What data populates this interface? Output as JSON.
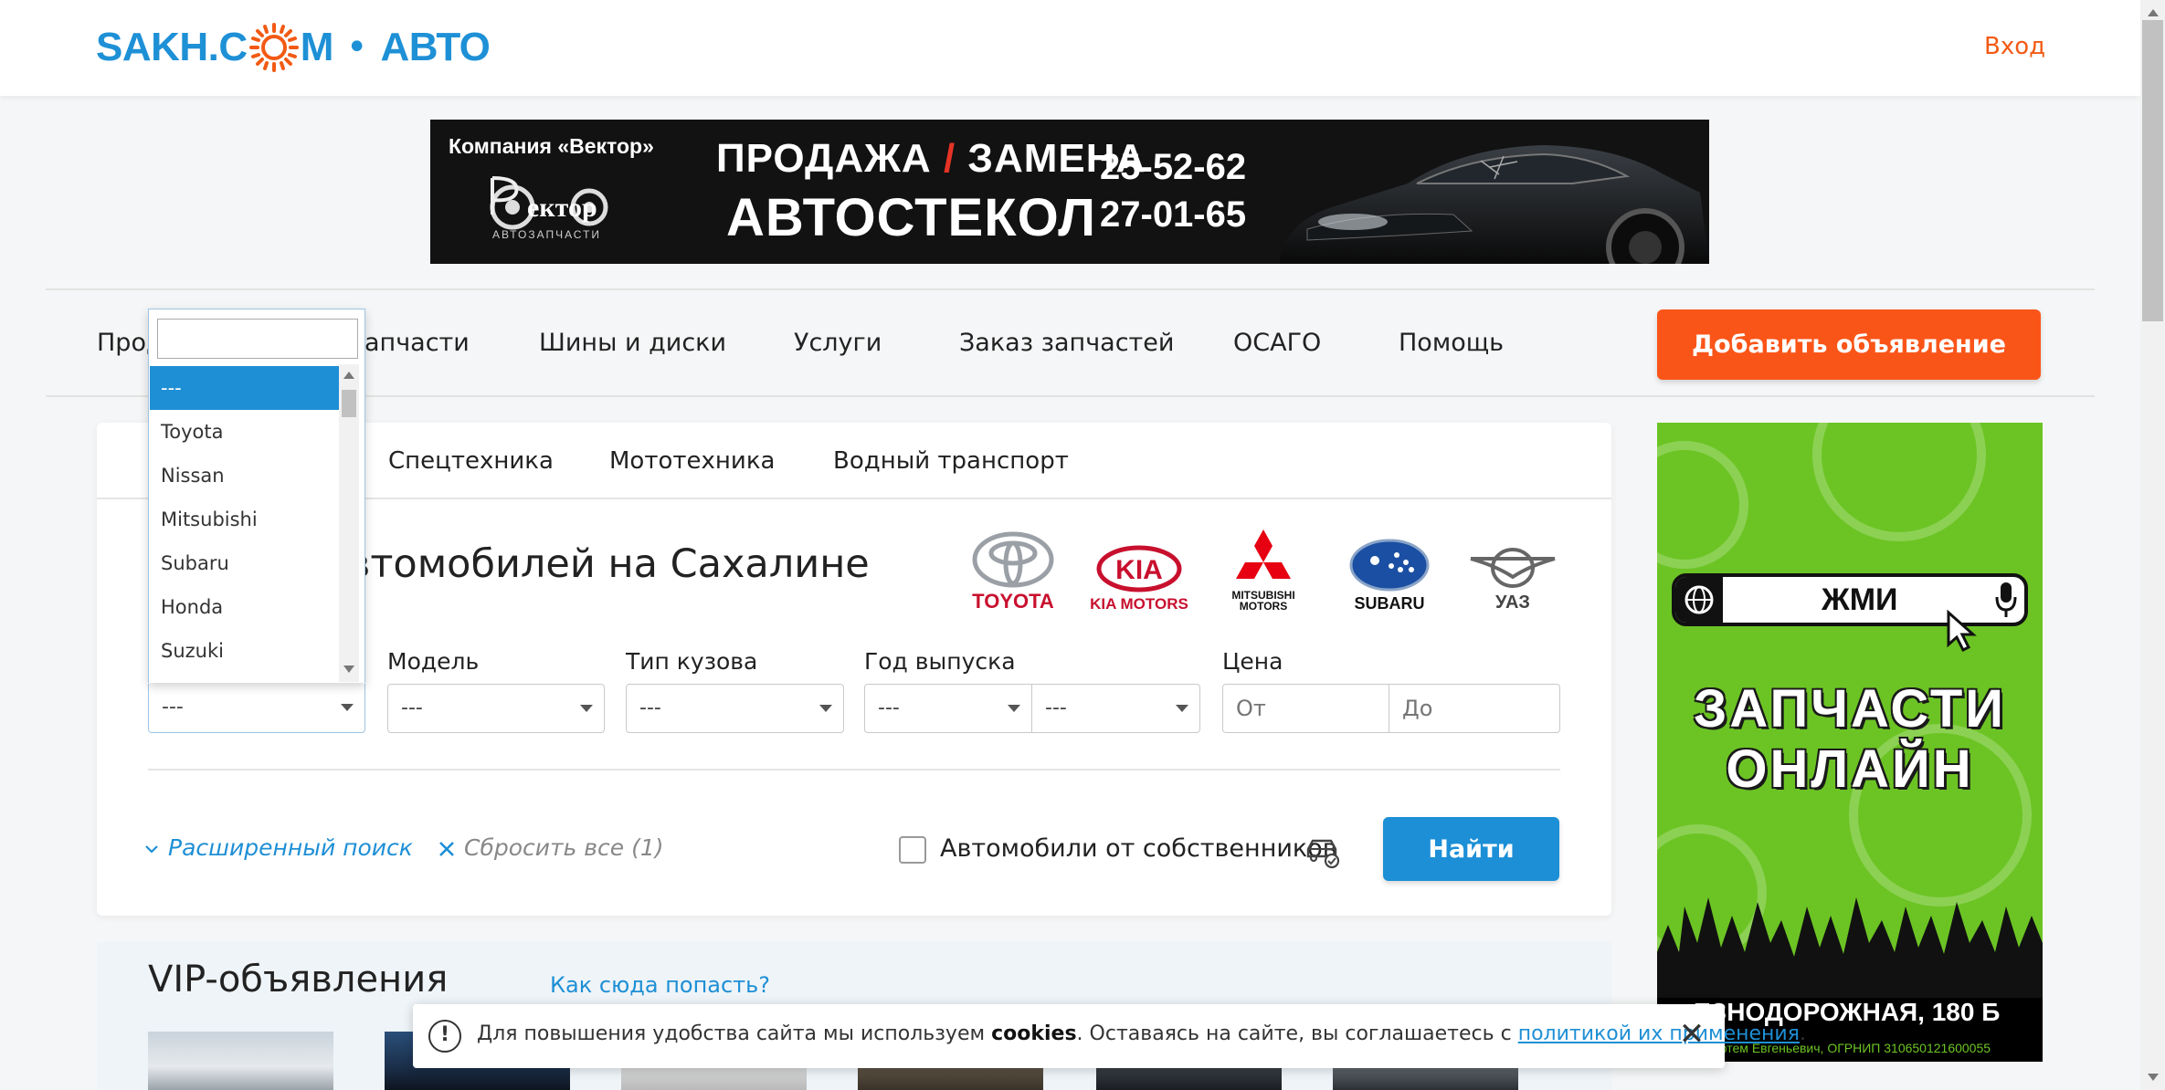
{
  "header": {
    "logo_part1": "SAKH.C",
    "logo_part2": "M",
    "logo_dot": "•",
    "logo_part3": "АВТО",
    "login": "Вход"
  },
  "banner": {
    "company": "Компания «Вектор»",
    "logo_text": "ектор",
    "logo_sub": "АВТОЗАПЧАСТИ",
    "line1_a": "ПРОДАЖА",
    "line1_slash": "/",
    "line1_b": "ЗАМЕНА",
    "line2": "АВТОСТЕКОЛ",
    "phone1": "25-52-62",
    "phone2": "27-01-65"
  },
  "nav": {
    "items": [
      "Прод",
      "апчасти",
      "Шины и диски",
      "Услуги",
      "Заказ запчастей",
      "ОСАГО",
      "Помощь"
    ],
    "add_button": "Добавить объявление"
  },
  "search": {
    "tabs": [
      "Спецтехника",
      "Мототехника",
      "Водный транспорт"
    ],
    "heading": "втомобилей на Сахалине",
    "brands": [
      {
        "name": "TOYOTA",
        "color": "#c8102e",
        "icon": "toyota-logo"
      },
      {
        "name": "KIA MOTORS",
        "color": "#c8102e",
        "icon": "kia-logo"
      },
      {
        "name": "MITSUBISHI MOTORS",
        "color": "#111111",
        "icon": "mitsubishi-logo"
      },
      {
        "name": "SUBARU",
        "color": "#111111",
        "icon": "subaru-logo"
      },
      {
        "name": "УАЗ",
        "color": "#333333",
        "icon": "uaz-logo"
      }
    ],
    "labels": {
      "model": "Модель",
      "body": "Тип кузова",
      "year": "Год выпуска",
      "price": "Цена"
    },
    "make_value": "---",
    "model_value": "---",
    "body_value": "---",
    "year_from_value": "---",
    "year_to_value": "---",
    "price_from_placeholder": "От",
    "price_to_placeholder": "До",
    "advanced": "Расширенный поиск",
    "reset": "Сбросить все (1)",
    "owners_label": "Автомобили от собственников",
    "find_button": "Найти",
    "make_dropdown": {
      "search_value": "",
      "options": [
        "---",
        "Toyota",
        "Nissan",
        "Mitsubishi",
        "Subaru",
        "Honda",
        "Suzuki"
      ],
      "selected": "---"
    }
  },
  "vip": {
    "title": "VIP-объявления",
    "link": "Как сюда попасть?"
  },
  "side_ad": {
    "search_text": "ЖМИ",
    "line1": "ЗАПЧАСТИ",
    "line2": "ОНЛАЙН",
    "address": "ЕЗНОДОРОЖНАЯ, 180 Б",
    "fine_print": "ин Артем Евгеньевич, ОГРНИП 310650121600055",
    "bg_color": "#6cc424"
  },
  "cookie": {
    "text_before": "Для повышения удобства сайта мы используем ",
    "bold": "cookies",
    "text_after": ". Оставаясь на сайте, вы соглашаетесь с ",
    "link": "политикой их применения",
    "end": ".",
    "icon": "!",
    "close": "✕"
  },
  "colors": {
    "accent_blue": "#1e8fd5",
    "accent_orange": "#fa5518"
  }
}
